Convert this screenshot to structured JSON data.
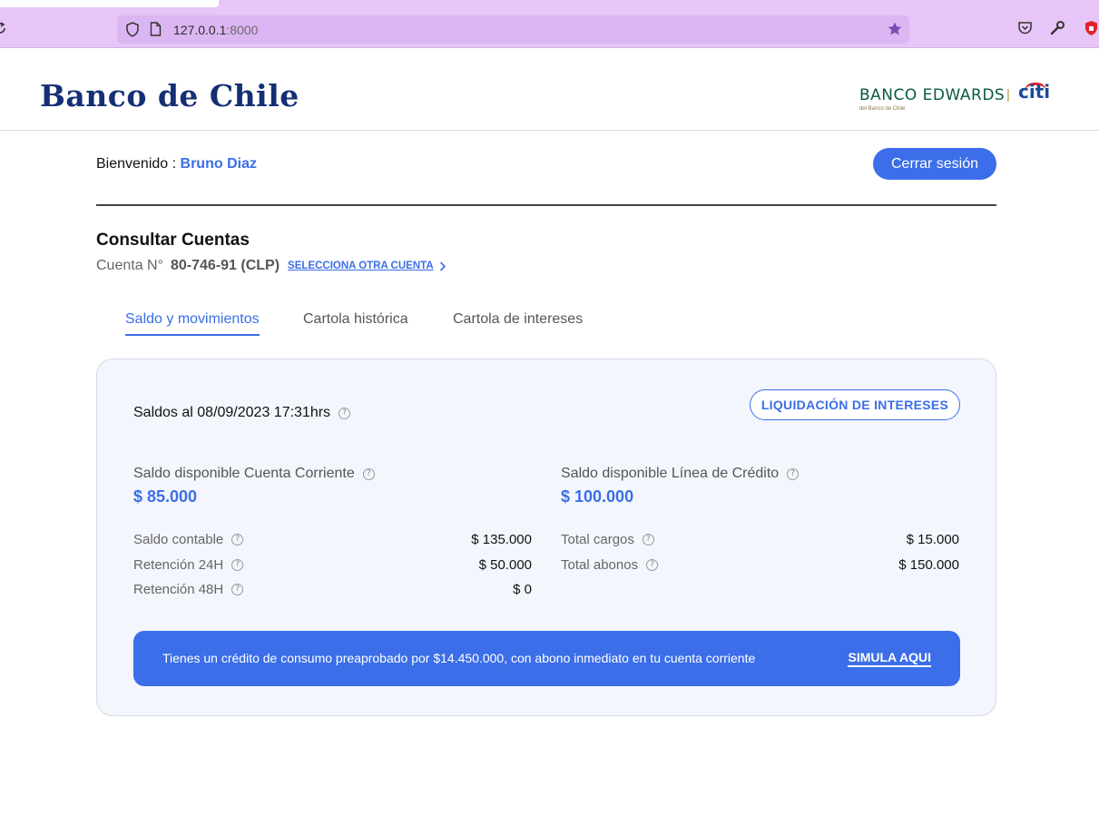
{
  "browser": {
    "url_host": "127.0.0.1",
    "url_port": ":8000"
  },
  "header": {
    "bank_logo": "Banco de Chile",
    "partner_logo": "BANCO EDWARDS",
    "partner_sub": "del Banco de Chile",
    "partner_sep": "|",
    "citi_logo": "citi"
  },
  "welcome": {
    "label": "Bienvenido : ",
    "user_name": "Bruno Diaz",
    "logout_label": "Cerrar sesión"
  },
  "section": {
    "title": "Consultar Cuentas",
    "account_label": "Cuenta N°",
    "account_number": "80-746-91 (CLP)",
    "select_other": "SELECCIONA OTRA CUENTA"
  },
  "tabs": [
    {
      "label": "Saldo y movimientos",
      "active": true
    },
    {
      "label": "Cartola histórica",
      "active": false
    },
    {
      "label": "Cartola de intereses",
      "active": false
    }
  ],
  "card": {
    "balance_date": "Saldos al 08/09/2023 17:31hrs",
    "liquidation_button": "LIQUIDACIÓN DE INTERESES",
    "left": {
      "title": "Saldo disponible Cuenta Corriente",
      "amount": "$ 85.000",
      "rows": [
        {
          "label": "Saldo contable",
          "value": "$ 135.000"
        },
        {
          "label": "Retención 24H",
          "value": "$ 50.000"
        },
        {
          "label": "Retención 48H",
          "value": "$ 0"
        }
      ]
    },
    "right": {
      "title": "Saldo disponible Línea de Crédito",
      "amount": "$ 100.000",
      "rows": [
        {
          "label": "Total cargos",
          "value": "$ 15.000"
        },
        {
          "label": "Total abonos",
          "value": "$ 150.000"
        }
      ]
    },
    "promo": {
      "text": "Tienes un crédito de consumo preaprobado por $14.450.000, con abono inmediato en tu cuenta corriente",
      "link": "SIMULA AQUI"
    }
  },
  "colors": {
    "accent": "#3b6ee8",
    "browser_chrome": "#e6c6f6",
    "card_bg": "#f3f6fd"
  },
  "icons": {
    "help": "?"
  }
}
